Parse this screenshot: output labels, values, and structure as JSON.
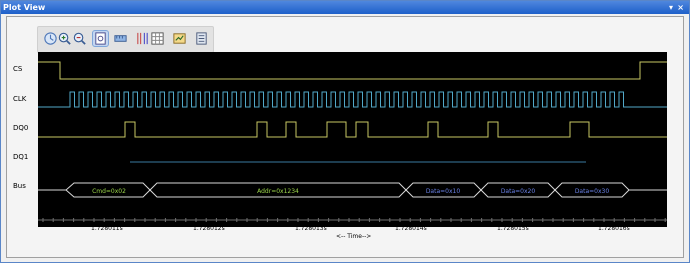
{
  "window": {
    "title": "Plot View",
    "pin_glyph": "▾",
    "close_glyph": "×"
  },
  "toolbar": {
    "buttons": [
      {
        "name": "pointer-tool-button",
        "icon": "pointer-icon"
      },
      {
        "name": "zoom-in-button",
        "icon": "zoom-in-icon"
      },
      {
        "name": "zoom-out-button",
        "icon": "zoom-out-icon"
      },
      {
        "name": "zoom-fit-button",
        "icon": "zoom-fit-icon",
        "active": true
      },
      {
        "name": "measure-button",
        "icon": "measure-icon"
      },
      {
        "name": "columns-button",
        "icon": "columns-icon"
      },
      {
        "name": "grid-button",
        "icon": "grid-icon"
      },
      {
        "name": "export-button",
        "icon": "export-icon"
      },
      {
        "name": "settings-button",
        "icon": "settings-icon"
      }
    ]
  },
  "signals": [
    {
      "name": "CS"
    },
    {
      "name": "CLK"
    },
    {
      "name": "DQ0"
    },
    {
      "name": "DQ1"
    },
    {
      "name": "Bus"
    }
  ],
  "bus_segments": [
    {
      "label": "Cmd=0x02",
      "color": "#9bd54a"
    },
    {
      "label": "Addr=0x1234",
      "color": "#9bd54a"
    },
    {
      "label": "Data=0x10",
      "color": "#6a82e6"
    },
    {
      "label": "Data=0x20",
      "color": "#6a82e6"
    },
    {
      "label": "Data=0x30",
      "color": "#6a82e6"
    }
  ],
  "time_axis": {
    "ticks": [
      "1.728011s",
      "1.728012s",
      "1.728013s",
      "1.728014s",
      "1.728015s",
      "1.728016s"
    ],
    "title": "<--  Time-->"
  },
  "colors": {
    "cs": "#c8c864",
    "clk": "#52a8c8",
    "dq0": "#c8c864",
    "dq1": "#3a7aa0",
    "bus": "#d8d8d8",
    "plot_bg": "#000000"
  }
}
